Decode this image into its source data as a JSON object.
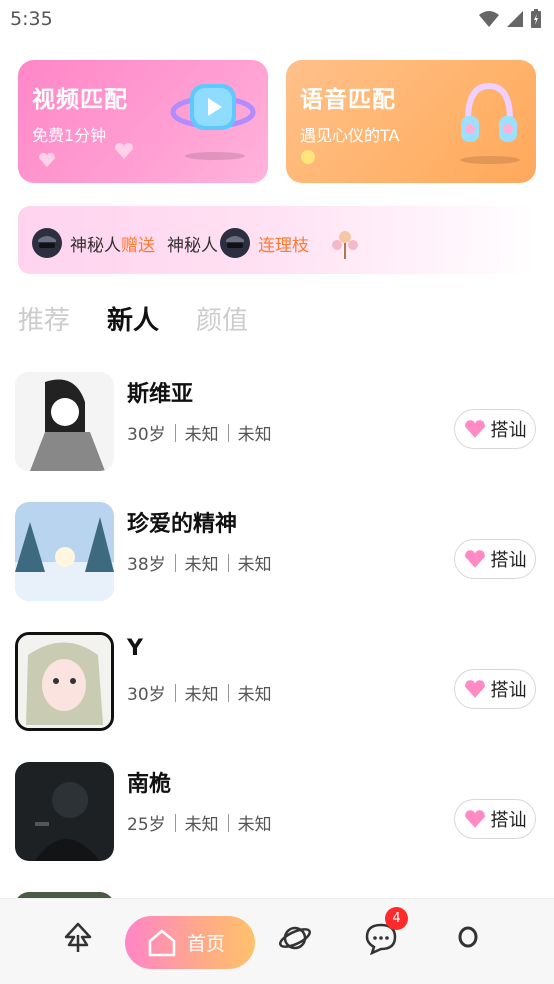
{
  "status_bar": {
    "time": "5:35",
    "icons": [
      "wifi-icon",
      "signal-icon",
      "battery-charging-icon"
    ]
  },
  "match_cards": {
    "video": {
      "title": "视频匹配",
      "subtitle": "免费1分钟"
    },
    "voice": {
      "title": "语音匹配",
      "subtitle": "遇见心仪的TA"
    }
  },
  "gift_banner": {
    "sender": "神秘人",
    "action": "赠送",
    "receiver": "神秘人",
    "gift": "连理枝"
  },
  "tabs": [
    {
      "label": "推荐",
      "active": false
    },
    {
      "label": "新人",
      "active": true
    },
    {
      "label": "颜值",
      "active": false
    }
  ],
  "users": [
    {
      "name": "斯维亚",
      "age": "30岁",
      "field1": "未知",
      "field2": "未知",
      "button": "搭讪"
    },
    {
      "name": "珍爱的精神",
      "age": "38岁",
      "field1": "未知",
      "field2": "未知",
      "button": "搭讪"
    },
    {
      "name": "Y",
      "age": "30岁",
      "field1": "未知",
      "field2": "未知",
      "button": "搭讪"
    },
    {
      "name": "南桅",
      "age": "25岁",
      "field1": "未知",
      "field2": "未知",
      "button": "搭讪"
    }
  ],
  "bottom_nav": {
    "home_label": "首页",
    "message_badge": "4",
    "icons": [
      "tree-icon",
      "home-icon",
      "planet-icon",
      "message-icon",
      "profile-icon"
    ]
  },
  "colors": {
    "pink": "#ff86c8",
    "orange": "#ffb36b",
    "highlight": "#ff7a2f",
    "badge": "#ff2a2a"
  }
}
